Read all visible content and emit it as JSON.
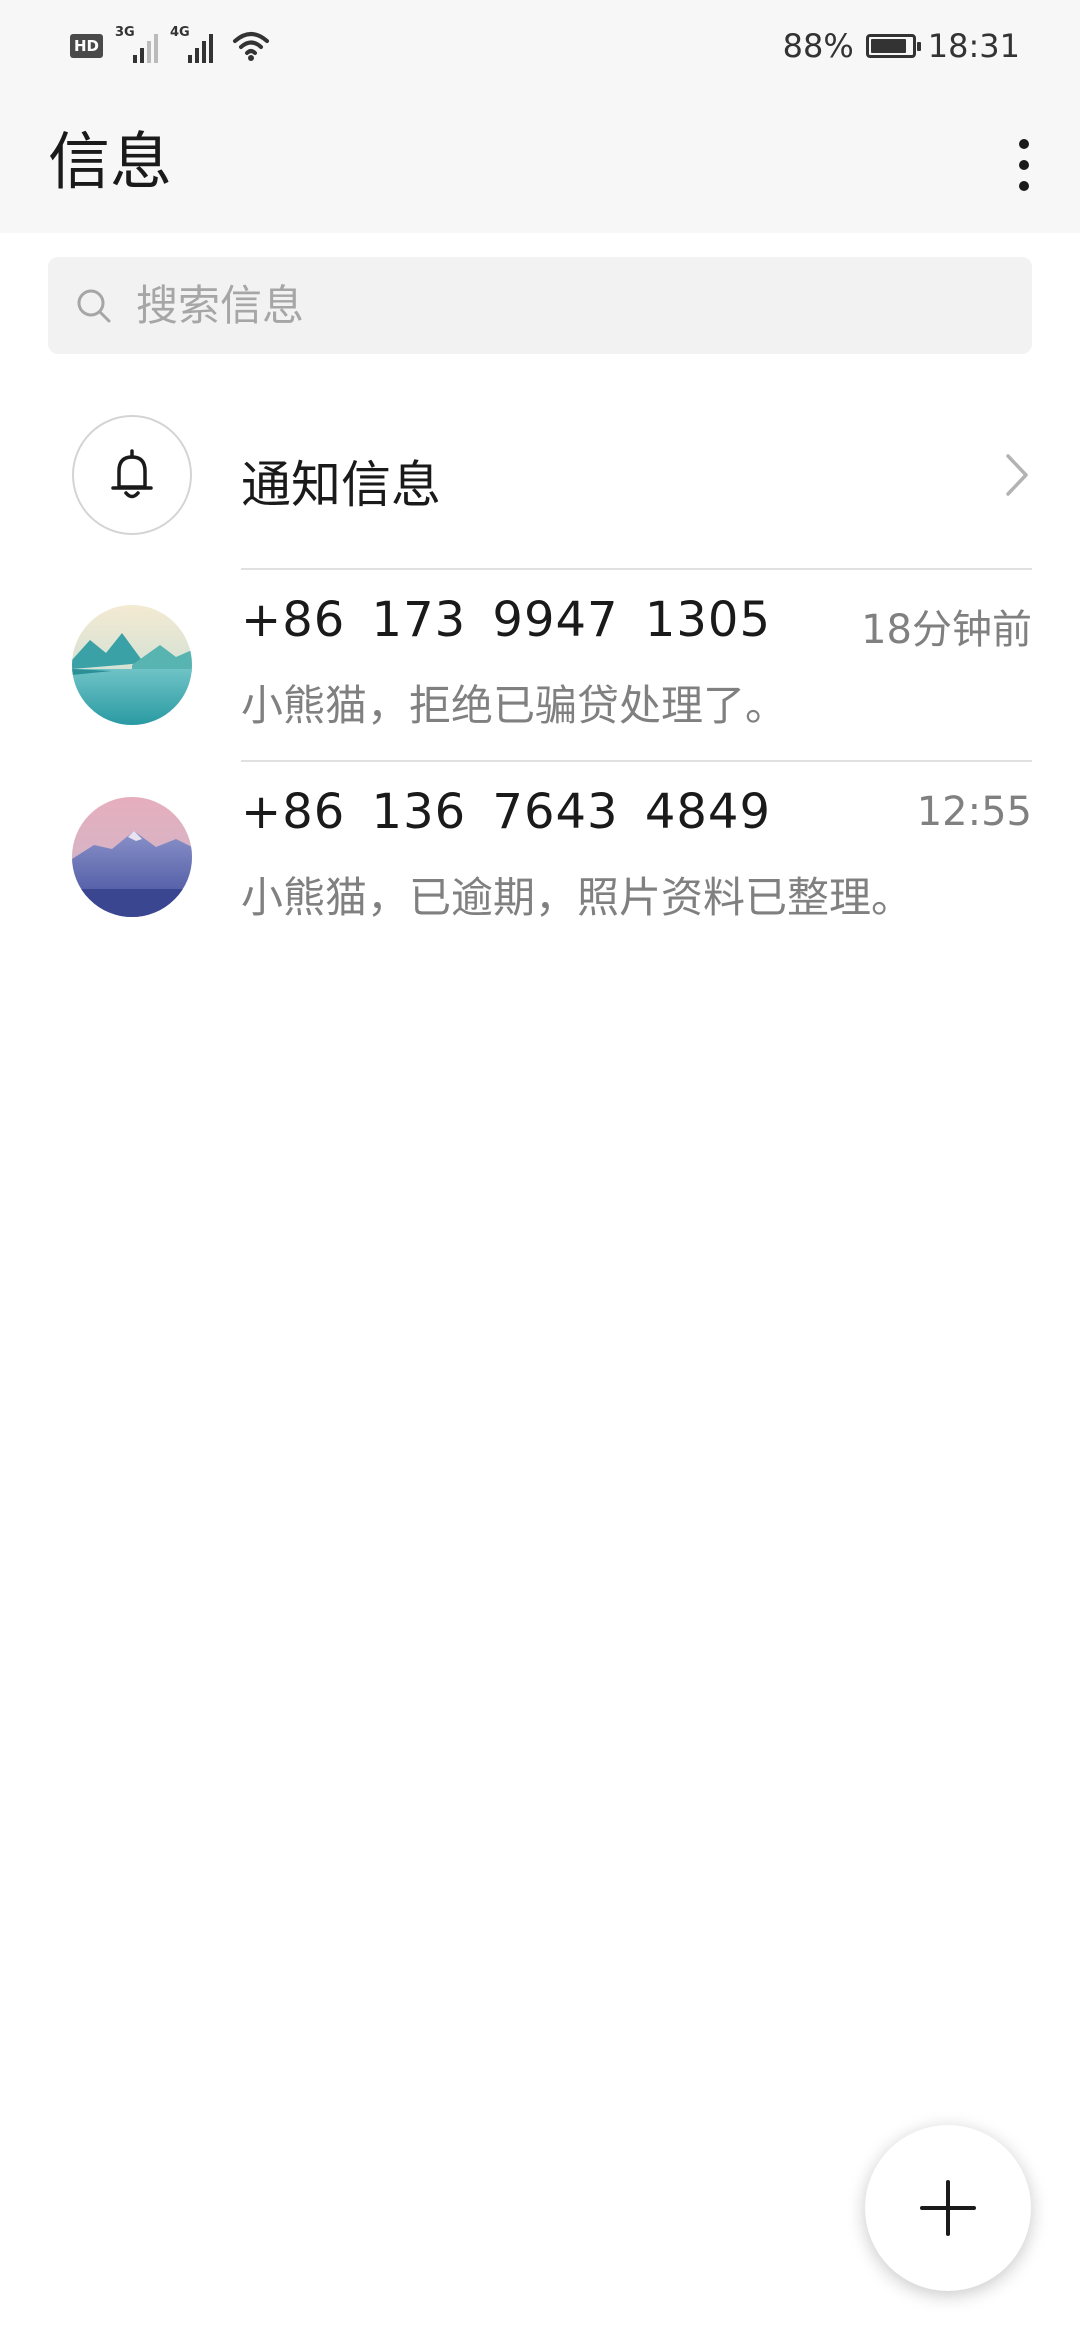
{
  "status_bar": {
    "hd_badge": "HD",
    "network_1": "3G",
    "network_2": "4G",
    "battery_percent": "88%",
    "battery_level": 0.88,
    "time": "18:31"
  },
  "app_bar": {
    "title": "信息",
    "more_icon": "more-vert-icon"
  },
  "search": {
    "placeholder": "搜索信息",
    "value": "",
    "icon": "search-icon"
  },
  "notifications": {
    "label": "通知信息",
    "icon": "bell-icon"
  },
  "conversations": [
    {
      "sender": "+86 173 9947 1305",
      "time": "18分钟前",
      "preview": "小熊猫，拒绝已骗贷处理了。",
      "avatar": "landscape-lake-avatar"
    },
    {
      "sender": "+86 136 7643 4849",
      "time": "12:55",
      "preview": "小熊猫，已逾期，照片资料已整理。",
      "avatar": "landscape-mountain-avatar"
    }
  ],
  "fab": {
    "icon": "plus-icon"
  },
  "colors": {
    "header_bg": "#f7f7f7",
    "search_bg": "#f2f2f2",
    "primary_text": "#1a1a1a",
    "secondary_text": "#808080",
    "divider": "#e0e0e0"
  }
}
